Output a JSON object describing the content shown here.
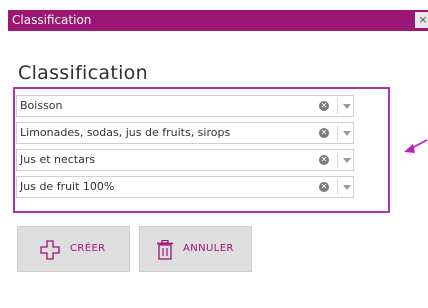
{
  "window": {
    "title": "Classification",
    "close_label": "×"
  },
  "form": {
    "heading": "Classification"
  },
  "selects": [
    {
      "value": "Boisson"
    },
    {
      "value": "Limonades, sodas, jus de fruits, sirops"
    },
    {
      "value": "Jus et nectars"
    },
    {
      "value": "Jus de fruit 100%"
    }
  ],
  "buttons": {
    "create_label": "CRÉER",
    "cancel_label": "ANNULER"
  },
  "icons": {
    "clear": "clear-icon",
    "dropdown": "chevron-down-icon",
    "create": "plus-icon",
    "cancel": "trash-icon",
    "annotation": "arrow-icon"
  },
  "colors": {
    "accent": "#9c1673",
    "highlight": "#b032b0",
    "button_bg": "#dedede"
  }
}
